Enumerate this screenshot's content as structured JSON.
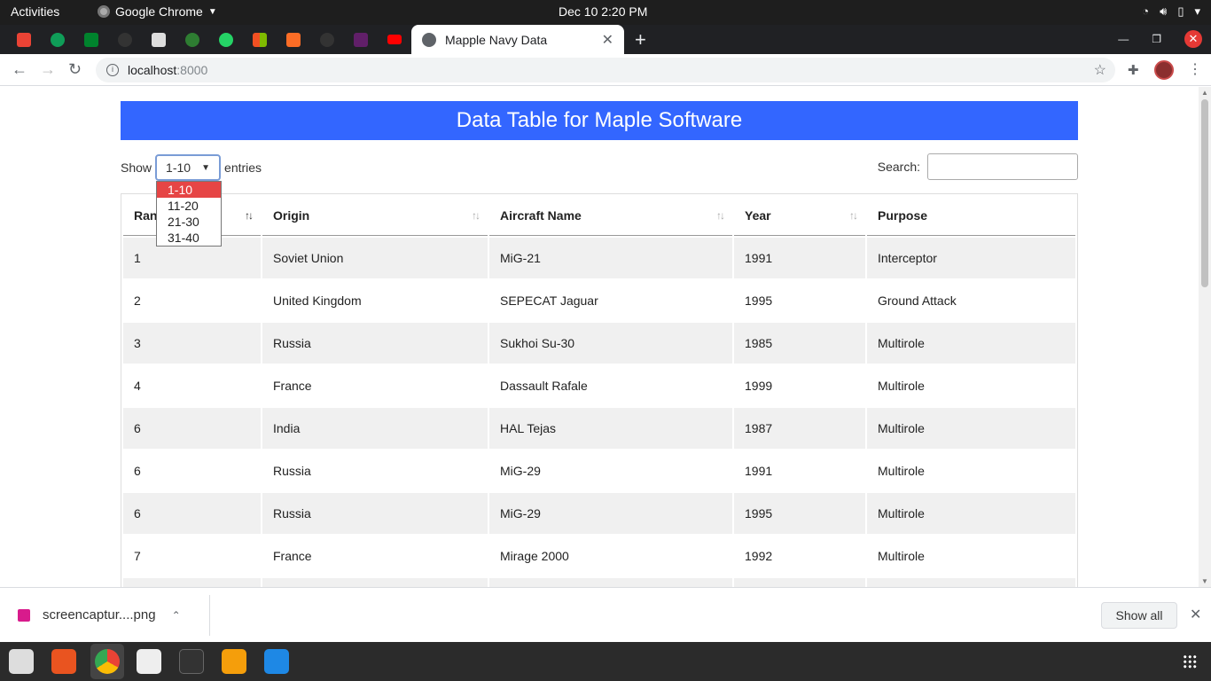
{
  "system": {
    "activities": "Activities",
    "app_name": "Google Chrome",
    "clock": "Dec 10  2:20 PM"
  },
  "browser": {
    "tab_title": "Mapple Navy Data",
    "url_host": "localhost",
    "url_port": ":8000"
  },
  "page": {
    "banner": "Data Table for Maple Software",
    "show_label": "Show",
    "entries_label": "entries",
    "selected_range": "1-10",
    "search_label": "Search:",
    "search_value": "",
    "range_options": [
      "1-10",
      "11-20",
      "21-30",
      "31-40"
    ],
    "columns": [
      "Rank",
      "Origin",
      "Aircraft Name",
      "Year",
      "Purpose"
    ],
    "rows": [
      [
        "1",
        "Soviet Union",
        "MiG-21",
        "1991",
        "Interceptor"
      ],
      [
        "2",
        "United Kingdom",
        "SEPECAT Jaguar",
        "1995",
        "Ground Attack"
      ],
      [
        "3",
        "Russia",
        "Sukhoi Su-30",
        "1985",
        "Multirole"
      ],
      [
        "4",
        "France",
        "Dassault Rafale",
        "1999",
        "Multirole"
      ],
      [
        "6",
        "India",
        "HAL Tejas",
        "1987",
        "Multirole"
      ],
      [
        "6",
        "Russia",
        "MiG-29",
        "1991",
        "Multirole"
      ],
      [
        "6",
        "Russia",
        "MiG-29",
        "1995",
        "Multirole"
      ],
      [
        "7",
        "France",
        "Mirage 2000",
        "1992",
        "Multirole"
      ],
      [
        "",
        "",
        "",
        "",
        ""
      ]
    ]
  },
  "downloads": {
    "filename": "screencaptur....png",
    "show_all": "Show all"
  },
  "colors": {
    "banner": "#3366ff",
    "selected_option": "#e64545"
  }
}
